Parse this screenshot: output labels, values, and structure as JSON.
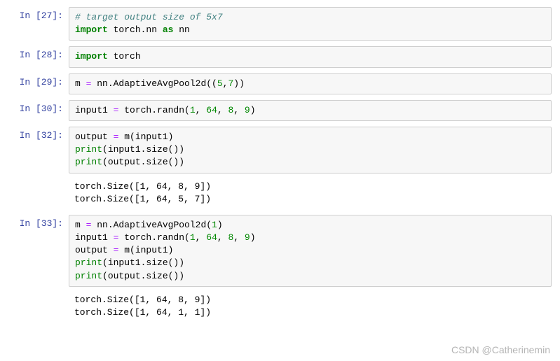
{
  "cells": [
    {
      "prompt": "In [27]:",
      "code_html": "<span class='c-comment'># target output size of 5x7</span>\n<span class='c-keyword'>import</span> torch.nn <span class='c-keyword'>as</span> nn"
    },
    {
      "prompt": "In [28]:",
      "code_html": "<span class='c-keyword'>import</span> torch"
    },
    {
      "prompt": "In [29]:",
      "code_html": "m <span class='c-op'>=</span> nn.AdaptiveAvgPool2d((<span class='c-num'>5</span>,<span class='c-num'>7</span>))"
    },
    {
      "prompt": "In [30]:",
      "code_html": "input1 <span class='c-op'>=</span> torch.randn(<span class='c-num'>1</span>, <span class='c-num'>64</span>, <span class='c-num'>8</span>, <span class='c-num'>9</span>)"
    },
    {
      "prompt": "In [32]:",
      "code_html": "output <span class='c-op'>=</span> m(input1)\n<span class='c-call'>print</span>(input1.size())\n<span class='c-call'>print</span>(output.size())",
      "output": "torch.Size([1, 64, 8, 9])\ntorch.Size([1, 64, 5, 7])"
    },
    {
      "prompt": "In [33]:",
      "code_html": "m <span class='c-op'>=</span> nn.AdaptiveAvgPool2d(<span class='c-num'>1</span>)\ninput1 <span class='c-op'>=</span> torch.randn(<span class='c-num'>1</span>, <span class='c-num'>64</span>, <span class='c-num'>8</span>, <span class='c-num'>9</span>)\noutput <span class='c-op'>=</span> m(input1)\n<span class='c-call'>print</span>(input1.size())\n<span class='c-call'>print</span>(output.size())",
      "output": "torch.Size([1, 64, 8, 9])\ntorch.Size([1, 64, 1, 1])"
    }
  ],
  "watermark": "CSDN @Catherinemin"
}
